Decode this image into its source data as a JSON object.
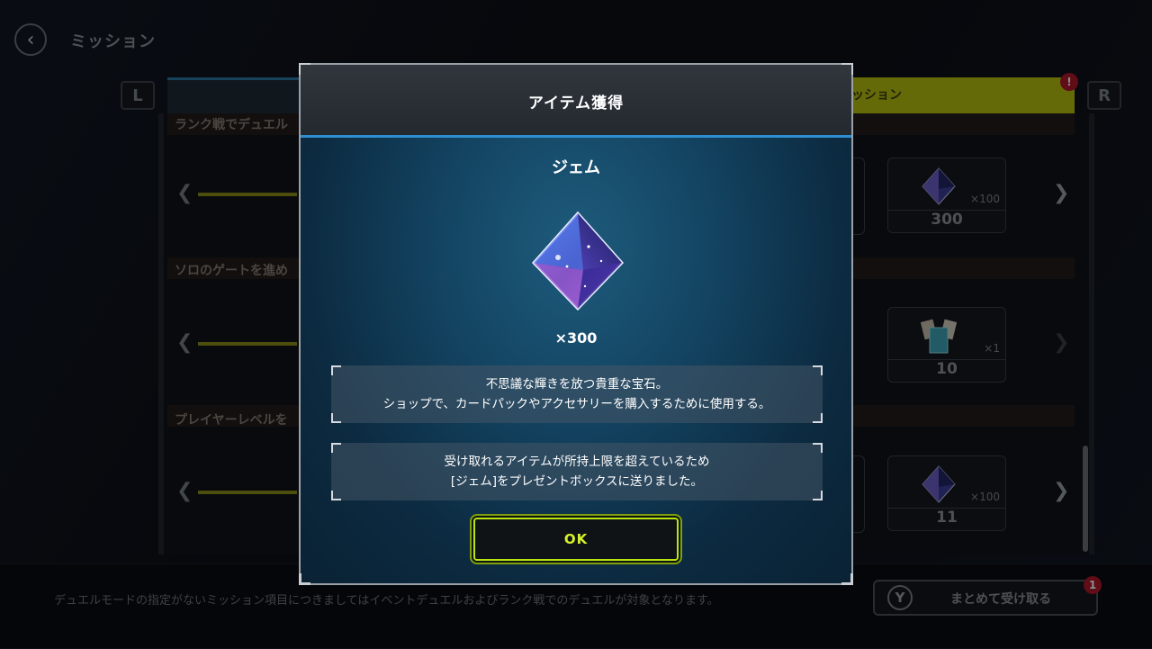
{
  "screen": {
    "title": "ミッション",
    "shoulder_left": "L",
    "shoulder_right": "R",
    "tab_right_label": "ッション",
    "tab_right_badge": "!",
    "rows": [
      {
        "head": "ランク戦でデュエル",
        "reward_qty": "×100",
        "reward_count": "300"
      },
      {
        "head": "ソロのゲートを進め",
        "reward_qty": "×1",
        "reward_count": "10"
      },
      {
        "head": "プレイヤーレベルを",
        "reward_qty": "×100",
        "reward_count": "11"
      }
    ],
    "footer_note": "デュエルモードの指定がないミッション項目につきましてはイベントデュエルおよびランク戦でのデュエルが対象となります。",
    "collect_key": "Y",
    "collect_label": "まとめて受け取る",
    "collect_badge": "1"
  },
  "modal": {
    "title": "アイテム獲得",
    "item_name": "ジェム",
    "item_quantity": "×300",
    "description_line1": "不思議な輝きを放つ貴重な宝石。",
    "description_line2": "ショップで、カードパックやアクセサリーを購入するために使用する。",
    "notice_line1": "受け取れるアイテムが所持上限を超えているため",
    "notice_line2": "[ジェム]をプレゼントボックスに送りました。",
    "ok_label": "OK"
  },
  "colors": {
    "accent_blue": "#2d8fcf",
    "ok_green": "#b8e40f",
    "tab_yellow": "#b8c20f",
    "badge_red": "#b0182a"
  },
  "icons": [
    "back-arrow-icon",
    "gem-icon",
    "card-pack-icon",
    "chevron-left-icon",
    "chevron-right-icon"
  ]
}
